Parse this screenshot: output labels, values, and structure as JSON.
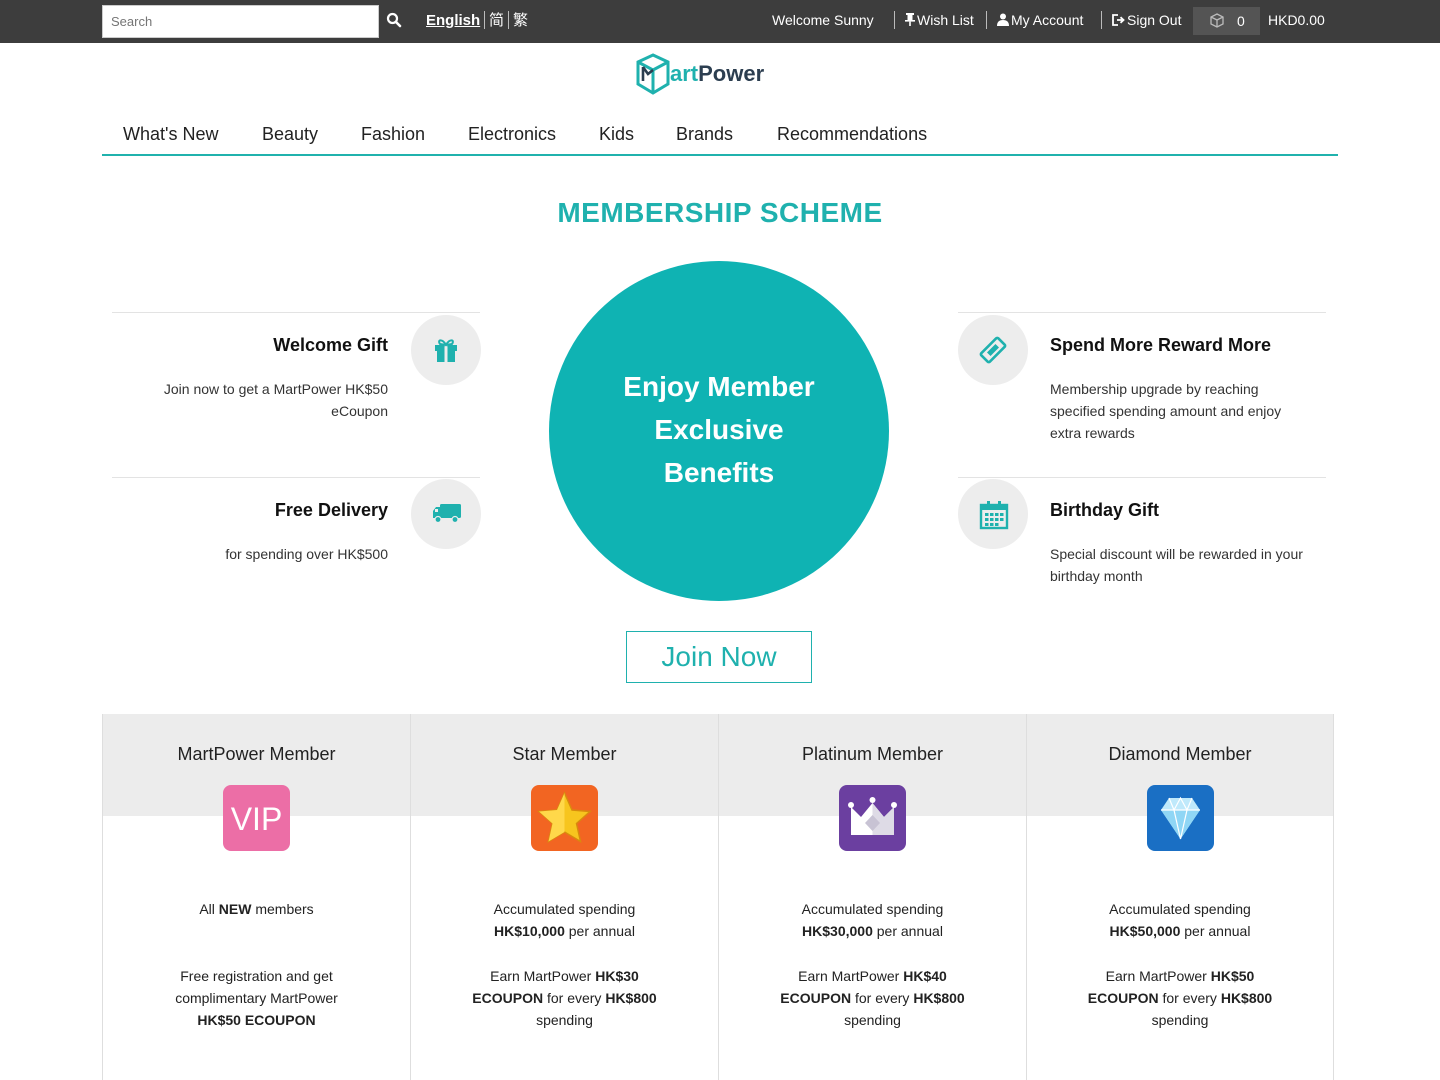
{
  "topbar": {
    "search_placeholder": "Search",
    "lang_en": "English",
    "lang_sc": "简",
    "lang_tc": "繁",
    "welcome": "Welcome Sunny",
    "wishlist": "Wish List",
    "account": "My Account",
    "signout": "Sign Out",
    "cart_count": "0",
    "cart_total": "HKD0.00"
  },
  "logo": {
    "part1": "art",
    "part2": "Power"
  },
  "nav": [
    "What's New",
    "Beauty",
    "Fashion",
    "Electronics",
    "Kids",
    "Brands",
    "Recommendations"
  ],
  "heading": "MEMBERSHIP SCHEME",
  "center": {
    "line1": "Enjoy Member",
    "line2": "Exclusive",
    "line3": "Benefits"
  },
  "features": {
    "welcome_gift": {
      "title": "Welcome Gift",
      "desc1": "Join now to get a MartPower HK$50",
      "desc2": "eCoupon"
    },
    "free_delivery": {
      "title": "Free Delivery",
      "desc1": "for spending over HK$500"
    },
    "spend_more": {
      "title": "Spend More Reward More",
      "desc1": "Membership upgrade by reaching",
      "desc2": "specified spending amount and enjoy",
      "desc3": "extra rewards"
    },
    "birthday": {
      "title": "Birthday Gift",
      "desc1": "Special discount will be rewarded in your",
      "desc2": "birthday month"
    }
  },
  "join_label": "Join Now",
  "tiers": [
    {
      "name": "MartPower Member",
      "badge": "VIP",
      "req_pre": "All ",
      "req_bold": "NEW",
      "req_post": " members",
      "ben1": "Free registration and get",
      "ben2": "complimentary MartPower",
      "ben3": "HK$50 ECOUPON"
    },
    {
      "name": "Star Member",
      "req1": "Accumulated spending",
      "req_amount": "HK$10,000",
      "req_suffix": " per annual",
      "earn_pre": "Earn MartPower ",
      "earn_amount": "HK$30",
      "earn_ecoupon": "ECOUPON",
      "earn_mid": " for every ",
      "earn_every": "HK$800",
      "earn_end": "spending"
    },
    {
      "name": "Platinum Member",
      "req1": "Accumulated spending",
      "req_amount": "HK$30,000",
      "req_suffix": " per annual",
      "earn_pre": "Earn MartPower ",
      "earn_amount": "HK$40",
      "earn_ecoupon": "ECOUPON",
      "earn_mid": " for every ",
      "earn_every": "HK$800",
      "earn_end": "spending"
    },
    {
      "name": "Diamond Member",
      "req1": "Accumulated spending",
      "req_amount": "HK$50,000",
      "req_suffix": " per annual",
      "earn_pre": "Earn MartPower ",
      "earn_amount": "HK$50",
      "earn_ecoupon": "ECOUPON",
      "earn_mid": " for every ",
      "earn_every": "HK$800",
      "earn_end": "spending"
    }
  ],
  "colors": {
    "accent": "#1fb1ae",
    "topbar": "#3d3d3d",
    "tier_header": "#ececec"
  },
  "icons": [
    "search-icon",
    "pin-icon",
    "user-icon",
    "sign-out-icon",
    "cart-box-icon",
    "gift-icon",
    "truck-icon",
    "ticket-icon",
    "calendar-icon",
    "vip-badge-icon",
    "star-badge-icon",
    "crown-badge-icon",
    "diamond-badge-icon"
  ]
}
